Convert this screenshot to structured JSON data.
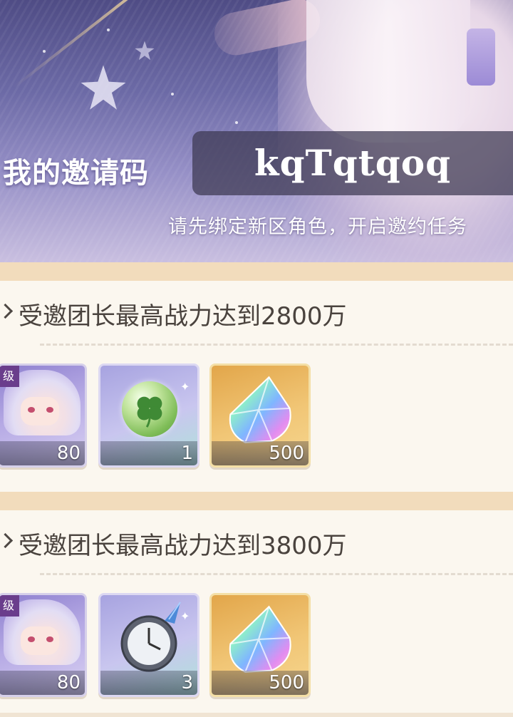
{
  "header": {
    "invite_label": "我的邀请码",
    "invite_code": "kqTqtqoq",
    "bind_hint": "请先绑定新区角色，开启邀约任务"
  },
  "tasks": [
    {
      "title": "受邀团长最高战力达到2800万",
      "rewards": [
        {
          "icon": "character-portrait-icon",
          "label_partial": "级",
          "qty": "80"
        },
        {
          "icon": "clover-orb-icon",
          "qty": "1"
        },
        {
          "icon": "rainbow-crystal-icon",
          "qty": "500"
        }
      ]
    },
    {
      "title": "受邀团长最高战力达到3800万",
      "rewards": [
        {
          "icon": "character-portrait-icon",
          "label_partial": "级",
          "qty": "80"
        },
        {
          "icon": "pocket-watch-icon",
          "qty": "3"
        },
        {
          "icon": "rainbow-crystal-icon",
          "qty": "500"
        }
      ]
    }
  ],
  "colors": {
    "card_bg": "#fbf7ef",
    "card_border": "#f2dcbc",
    "title_text": "#4a433e",
    "code_box": "#3c3850"
  }
}
